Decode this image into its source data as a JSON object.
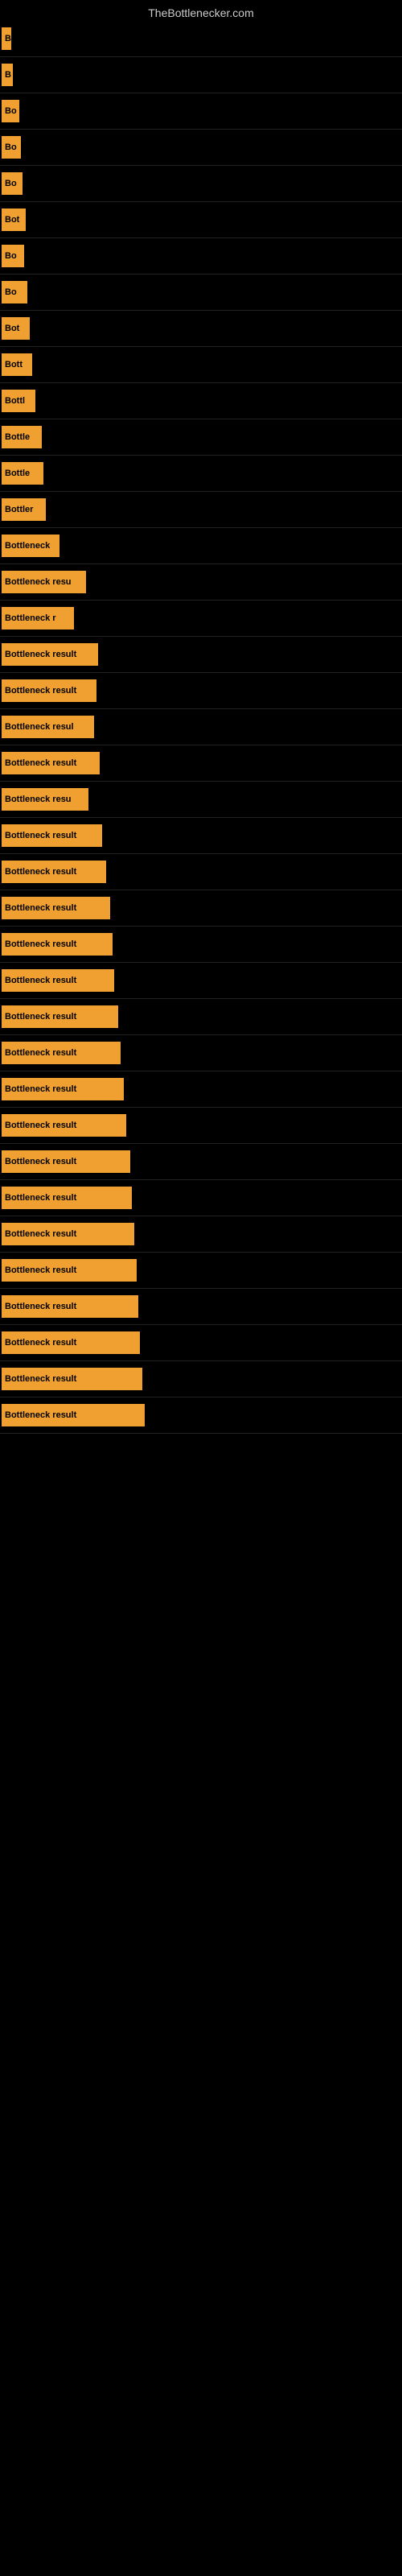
{
  "site": {
    "title": "TheBottlenecker.com"
  },
  "bars": [
    {
      "label": "B",
      "width": 12
    },
    {
      "label": "B",
      "width": 14
    },
    {
      "label": "Bo",
      "width": 22
    },
    {
      "label": "Bo",
      "width": 24
    },
    {
      "label": "Bo",
      "width": 26
    },
    {
      "label": "Bot",
      "width": 30
    },
    {
      "label": "Bo",
      "width": 28
    },
    {
      "label": "Bo",
      "width": 32
    },
    {
      "label": "Bot",
      "width": 35
    },
    {
      "label": "Bott",
      "width": 38
    },
    {
      "label": "Bottl",
      "width": 42
    },
    {
      "label": "Bottle",
      "width": 50
    },
    {
      "label": "Bottle",
      "width": 52
    },
    {
      "label": "Bottler",
      "width": 55
    },
    {
      "label": "Bottleneck",
      "width": 72
    },
    {
      "label": "Bottleneck resu",
      "width": 105
    },
    {
      "label": "Bottleneck r",
      "width": 90
    },
    {
      "label": "Bottleneck result",
      "width": 120
    },
    {
      "label": "Bottleneck result",
      "width": 118
    },
    {
      "label": "Bottleneck resul",
      "width": 115
    },
    {
      "label": "Bottleneck result",
      "width": 122
    },
    {
      "label": "Bottleneck resu",
      "width": 108
    },
    {
      "label": "Bottleneck result",
      "width": 125
    },
    {
      "label": "Bottleneck result",
      "width": 130
    },
    {
      "label": "Bottleneck result",
      "width": 135
    },
    {
      "label": "Bottleneck result",
      "width": 138
    },
    {
      "label": "Bottleneck result",
      "width": 140
    },
    {
      "label": "Bottleneck result",
      "width": 145
    },
    {
      "label": "Bottleneck result",
      "width": 148
    },
    {
      "label": "Bottleneck result",
      "width": 152
    },
    {
      "label": "Bottleneck result",
      "width": 155
    },
    {
      "label": "Bottleneck result",
      "width": 160
    },
    {
      "label": "Bottleneck result",
      "width": 162
    },
    {
      "label": "Bottleneck result",
      "width": 165
    },
    {
      "label": "Bottleneck result",
      "width": 168
    },
    {
      "label": "Bottleneck result",
      "width": 170
    },
    {
      "label": "Bottleneck result",
      "width": 172
    },
    {
      "label": "Bottleneck result",
      "width": 175
    },
    {
      "label": "Bottleneck result",
      "width": 178
    }
  ]
}
